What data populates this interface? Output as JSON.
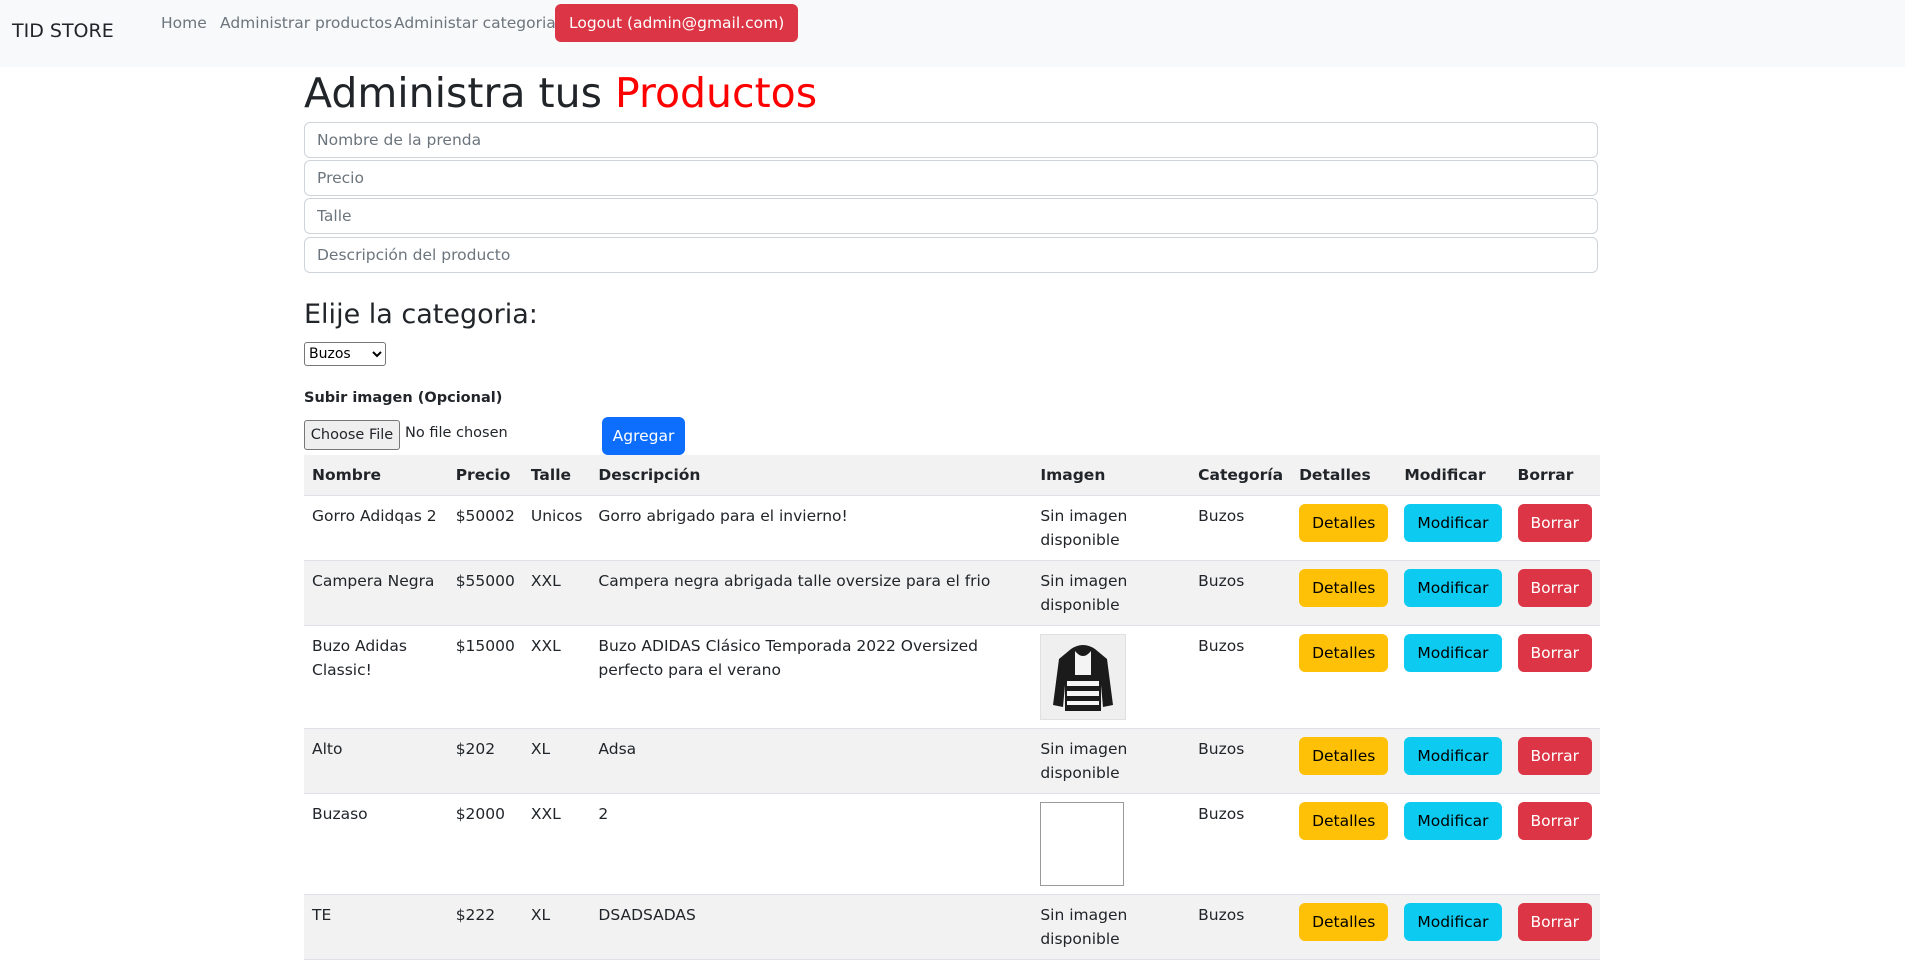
{
  "navbar": {
    "brand": "TID STORE",
    "links": [
      "Home",
      "Administrar productos",
      "Administar categorias"
    ],
    "logout": "Logout (admin@gmail.com)"
  },
  "page": {
    "title_prefix": "Administra tus",
    "title_accent": "Productos"
  },
  "form": {
    "name_placeholder": "Nombre de la prenda",
    "price_placeholder": "Precio",
    "size_placeholder": "Talle",
    "description_placeholder": "Descripción del producto",
    "category_heading": "Elije la categoria:",
    "category_selected": "Buzos",
    "upload_label": "Subir imagen (Opcional)",
    "file_button": "Choose File",
    "file_status": "No file chosen",
    "add_button": "Agregar"
  },
  "table": {
    "headers": [
      "Nombre",
      "Precio",
      "Talle",
      "Descripción",
      "Imagen",
      "Categoría",
      "Detalles",
      "Modificar",
      "Borrar"
    ],
    "actions": {
      "details": "Detalles",
      "modify": "Modificar",
      "delete": "Borrar"
    },
    "no_image_text": "Sin imagen disponible",
    "rows": [
      {
        "name": "Gorro Adidqas 2",
        "price": "$50002",
        "size": "Unicos",
        "description": "Gorro abrigado para el invierno!",
        "category": "Buzos"
      },
      {
        "name": "Campera Negra",
        "price": "$55000",
        "size": "XXL",
        "description": "Campera negra abrigada talle oversize para el frio",
        "category": "Buzos"
      },
      {
        "name": "Buzo Adidas Classic!",
        "price": "$15000",
        "size": "XXL",
        "description": "Buzo ADIDAS Clásico Temporada 2022 Oversized perfecto para el verano",
        "category": "Buzos"
      },
      {
        "name": "Alto",
        "price": "$202",
        "size": "XL",
        "description": "Adsa",
        "category": "Buzos"
      },
      {
        "name": "Buzaso",
        "price": "$2000",
        "size": "XXL",
        "description": "2",
        "category": "Buzos"
      },
      {
        "name": "TE",
        "price": "$222",
        "size": "XL",
        "description": "DSADSADAS",
        "category": "Buzos"
      }
    ]
  }
}
